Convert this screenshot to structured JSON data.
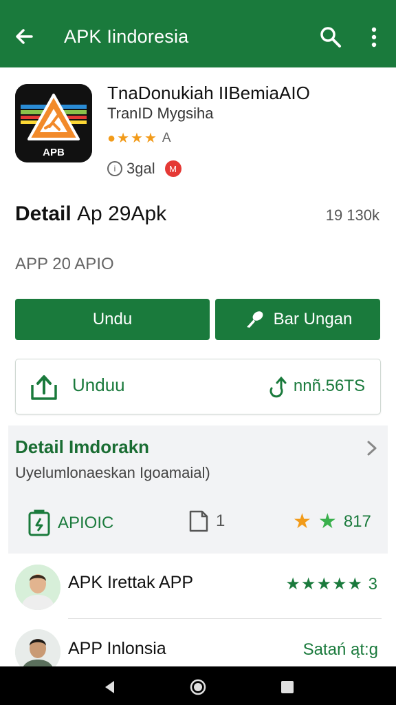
{
  "appbar": {
    "title": "APK Iindoresia",
    "color": "#1a7a3c"
  },
  "app": {
    "name": "TnaDonukiah IIBemiaAIO",
    "developer": "TranID Mygsiha",
    "rating_label": "A",
    "meta_label": "3gal",
    "meta_badge": "M",
    "icon_text": "APB"
  },
  "detail": {
    "title": "Detail",
    "subtitle": "Ap 29Apk",
    "size": "19 130k",
    "version": "APP 20 APIO"
  },
  "buttons": {
    "download": "Undu",
    "share": "Bar Ungan"
  },
  "download_card": {
    "label": "Unduu",
    "count": "nnñ.56TS"
  },
  "info": {
    "heading": "Detail Imdorakn",
    "description": "Uyelumlonaeskan Igoamaial)",
    "stat_apk": "APIOIC",
    "stat_files": "1",
    "stat_rating": "817"
  },
  "list": [
    {
      "name": "APK Irettak APP",
      "right": "★★★★★ 3"
    },
    {
      "name": "APP Inlonsia",
      "right": "Satań ąt:g"
    }
  ],
  "icons": {
    "back": "back-arrow-icon",
    "search": "search-icon",
    "more": "more-vert-icon",
    "share": "share-key-icon",
    "upload": "upload-box-icon",
    "update": "update-arrow-icon",
    "apk": "apk-file-icon",
    "files": "file-icon",
    "chevron": "chevron-right-icon"
  }
}
